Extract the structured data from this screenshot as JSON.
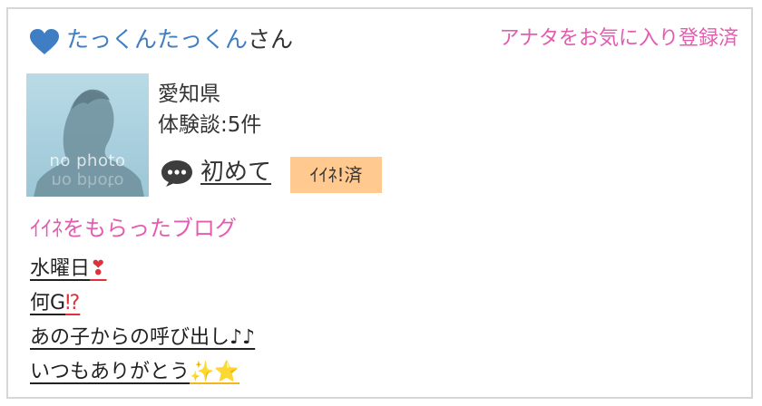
{
  "profile": {
    "name": "たっくんたっくん",
    "name_suffix": "さん",
    "favorite_status": "アナタをお気に入り登録済",
    "avatar_caption": "no photo",
    "prefecture": "愛知県",
    "review_count": "体験談:5件",
    "status_link": "初めて",
    "like_badge": "ｲｲﾈ!済",
    "icons": {
      "heart": "heart-icon",
      "speech": "speech-bubble-icon"
    },
    "colors": {
      "name_blue": "#3f7ec2",
      "accent_pink": "#e45bb0",
      "badge_orange": "#ffc98f",
      "avatar_bg": "#a9cfdc"
    }
  },
  "liked_blogs": {
    "heading": "ｲｲﾈをもらったブログ",
    "items": [
      {
        "title": "水曜日",
        "emoji": "❣"
      },
      {
        "title": "何G",
        "emoji": "⁉"
      },
      {
        "title": "あの子からの呼び出し",
        "emoji": "♪♪"
      },
      {
        "title": "いつもありがとう",
        "emoji": "✨⭐"
      }
    ]
  }
}
